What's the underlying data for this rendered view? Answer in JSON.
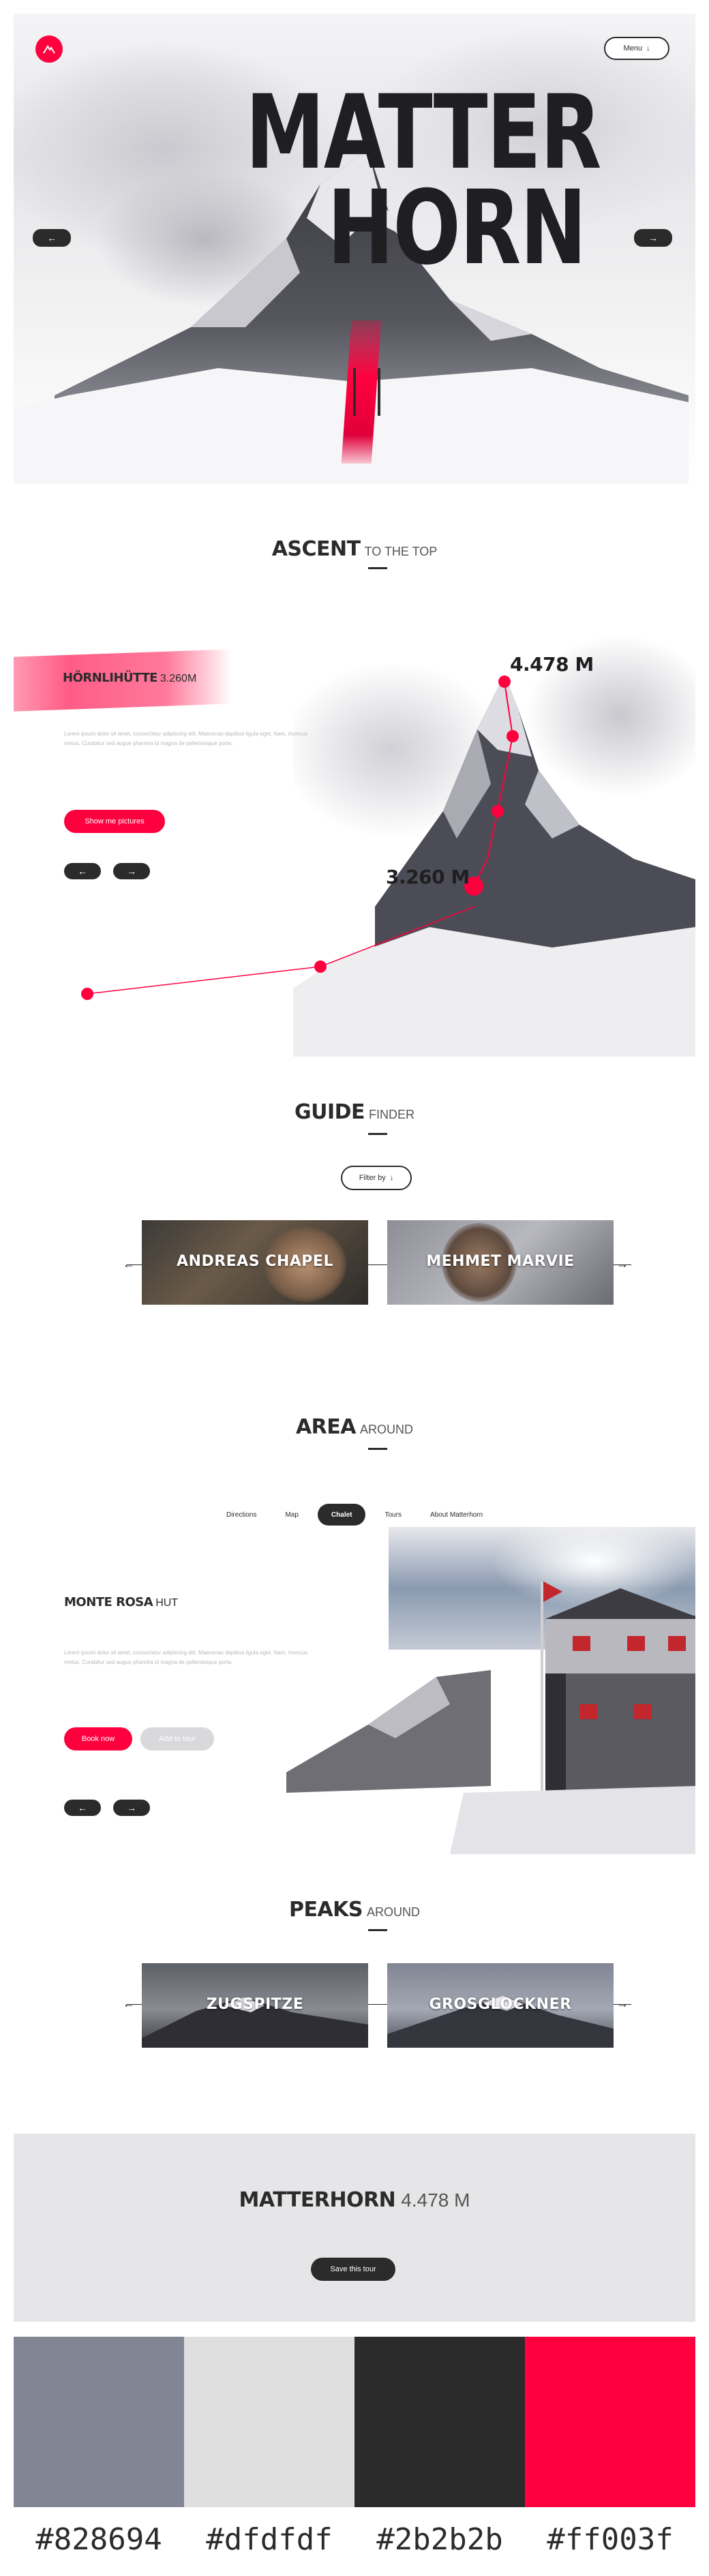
{
  "hero": {
    "title_line1": "MATTER",
    "title_line2": "HORN",
    "menu_label": "Menu"
  },
  "ascent": {
    "heading_bold": "ASCENT",
    "heading_light": "TO THE TOP",
    "subtitle_bold": "HÖRNLIHÜTTE",
    "subtitle_light": "3.260M",
    "paragraph": "Lorem ipsum dolor sit amet, consectetur adipiscing elit. Maecenas dapibus ligula eget. Nam, rhoncus metus. Curabitur sed augue pharetra id magna de pellentesque porta.",
    "cta_label": "Show me pictures",
    "peak_label": "4.478 M",
    "hut_label": "3.260 M"
  },
  "guide": {
    "heading_bold": "GUIDE",
    "heading_light": "FINDER",
    "filter_label": "Filter by",
    "cards": [
      {
        "label": "ANDREAS CHAPEL"
      },
      {
        "label": "MEHMET MARVIE"
      }
    ]
  },
  "area": {
    "heading_bold": "AREA",
    "heading_light": "AROUND",
    "tabs": [
      "Directions",
      "Map",
      "Chalet",
      "Tours",
      "About Matterhorn"
    ],
    "active_tab": "Chalet",
    "subtitle_bold": "MONTE ROSA",
    "subtitle_light": "HUT",
    "paragraph": "Lorem ipsum dolor sit amet, consectetur adipiscing elit. Maecenas dapibus ligula eget. Nam, rhoncus metus. Curabitur sed augue pharetra id magna de pellentesque porta.",
    "book_label": "Book now",
    "add_label": "Add to tour"
  },
  "peaks": {
    "heading_bold": "PEAKS",
    "heading_light": "AROUND",
    "cards": [
      {
        "label": "ZUGSPITZE"
      },
      {
        "label": "GROSGLOCKNER"
      }
    ]
  },
  "footer": {
    "title_bold": "MATTERHORN",
    "title_light": "4.478 M",
    "cta_label": "Save this tour"
  },
  "palette": [
    {
      "hex": "#828694",
      "label": "#828694"
    },
    {
      "hex": "#dfdfdf",
      "label": "#dfdfdf"
    },
    {
      "hex": "#2b2b2b",
      "label": "#2b2b2b"
    },
    {
      "hex": "#ff003f",
      "label": "#ff003f"
    }
  ],
  "icons": {
    "logo": "mountain-logo-icon",
    "prev": "arrow-left-icon",
    "next": "arrow-right-icon",
    "down": "chevron-down-icon"
  }
}
